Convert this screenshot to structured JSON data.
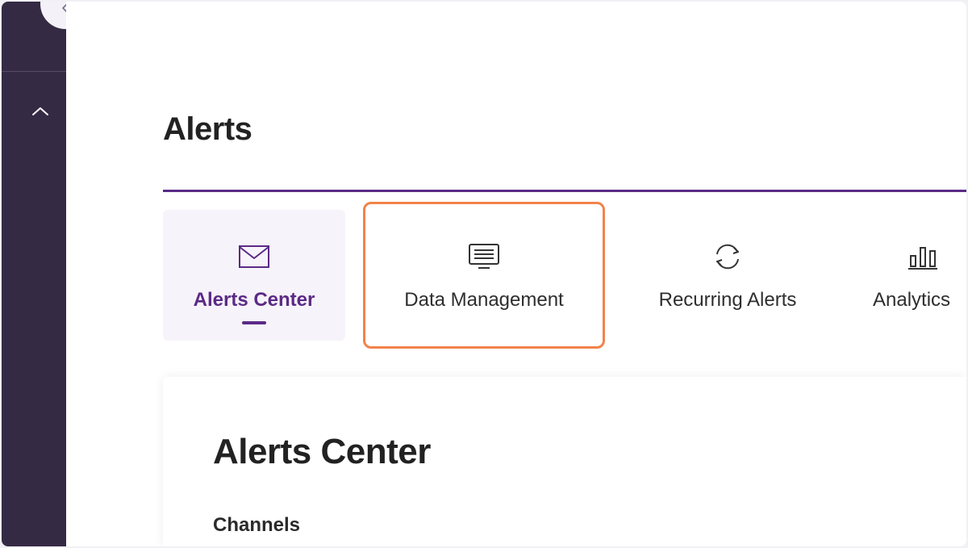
{
  "sidebar": {
    "collapse_icon": "chevron-left-icon",
    "expand_icon": "chevron-up-icon"
  },
  "page": {
    "title": "Alerts"
  },
  "tabs": [
    {
      "label": "Alerts Center",
      "icon": "envelope-icon",
      "active": true
    },
    {
      "label": "Data Management",
      "icon": "monitor-list-icon",
      "active": false,
      "highlighted": true
    },
    {
      "label": "Recurring Alerts",
      "icon": "refresh-icon",
      "active": false
    },
    {
      "label": "Analytics",
      "icon": "bar-chart-icon",
      "active": false
    }
  ],
  "panel": {
    "title": "Alerts Center",
    "section_label": "Channels"
  },
  "colors": {
    "sidebar": "#352a44",
    "accent": "#5b2a86",
    "highlight": "#f2834a"
  }
}
